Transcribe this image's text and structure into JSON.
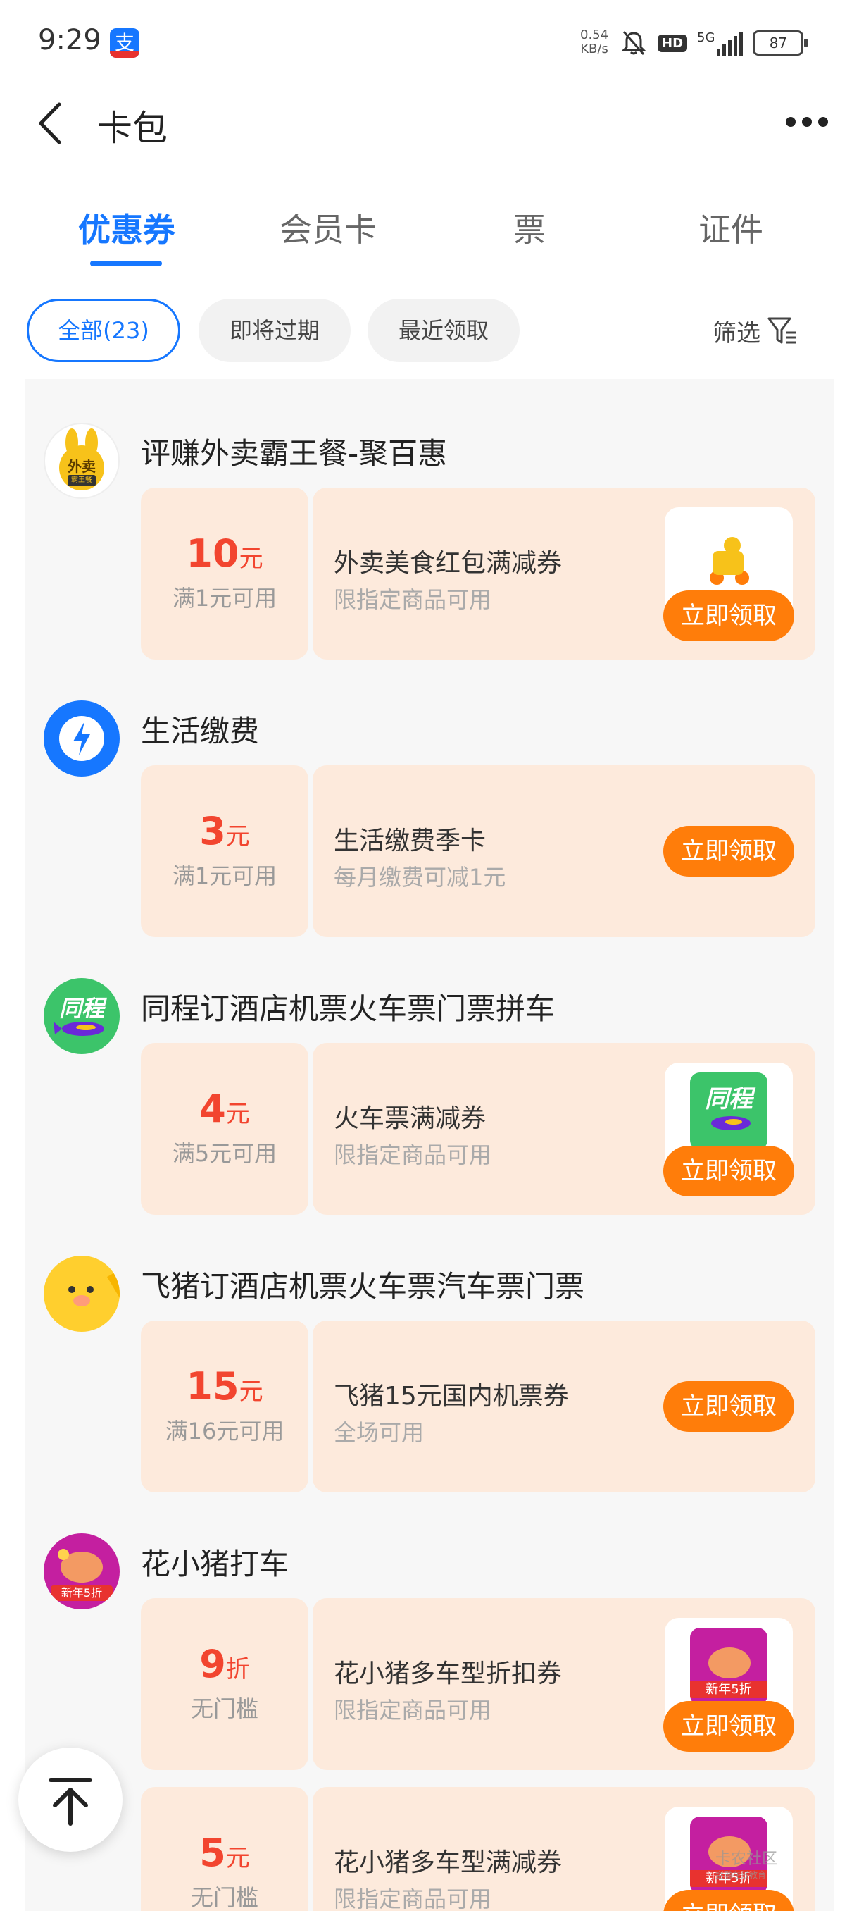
{
  "status": {
    "time": "9:29",
    "app_icon_text": "支",
    "net_speed": "0.54",
    "net_unit": "KB/s",
    "hd": "HD",
    "network": "5G",
    "battery": "87"
  },
  "header": {
    "title": "卡包"
  },
  "tabs": [
    {
      "label": "优惠券",
      "active": true
    },
    {
      "label": "会员卡",
      "active": false
    },
    {
      "label": "票",
      "active": false
    },
    {
      "label": "证件",
      "active": false
    }
  ],
  "filters": {
    "all": "全部(23)",
    "expiring": "即将过期",
    "recent": "最近领取",
    "filter": "筛选"
  },
  "merchants": [
    {
      "name": "评赚外卖霸王餐-聚百惠",
      "logo_text": "外卖",
      "logo_sub": "霸王餐",
      "coupon": {
        "amount": "10",
        "unit": "元",
        "condition": "满1元可用",
        "title": "外卖美食红包满减券",
        "sub": "限指定商品可用",
        "button": "立即领取"
      }
    },
    {
      "name": "生活缴费",
      "coupon": {
        "amount": "3",
        "unit": "元",
        "condition": "满1元可用",
        "title": "生活缴费季卡",
        "sub": "每月缴费可减1元",
        "button": "立即领取"
      }
    },
    {
      "name": "同程订酒店机票火车票门票拼车",
      "logo_text": "同程",
      "coupon": {
        "amount": "4",
        "unit": "元",
        "condition": "满5元可用",
        "title": "火车票满减券",
        "sub": "限指定商品可用",
        "button": "立即领取",
        "thumb_text": "同程"
      }
    },
    {
      "name": "飞猪订酒店机票火车票汽车票门票",
      "coupon": {
        "amount": "15",
        "unit": "元",
        "condition": "满16元可用",
        "title": "飞猪15元国内机票券",
        "sub": "全场可用",
        "button": "立即领取"
      }
    },
    {
      "name": "花小猪打车",
      "logo_text": "新年5折",
      "coupon": {
        "amount": "9",
        "unit": "折",
        "condition": "无门槛",
        "title": "花小猪多车型折扣券",
        "sub": "限指定商品可用",
        "button": "立即领取",
        "thumb_text": "新年5折"
      }
    },
    {
      "coupon": {
        "amount": "5",
        "unit": "元",
        "condition": "无门槛",
        "title": "花小猪多车型满减券",
        "sub": "限指定商品可用",
        "button": "立即领取",
        "thumb_text": "新年5折"
      }
    }
  ],
  "watermark": {
    "line1": "卡农社区",
    "line2": "金融在线教育"
  },
  "colors": {
    "accent": "#1677ff",
    "coupon_bg": "#fdeadc",
    "amount": "#f2452f",
    "button": "#ff7d0a"
  }
}
